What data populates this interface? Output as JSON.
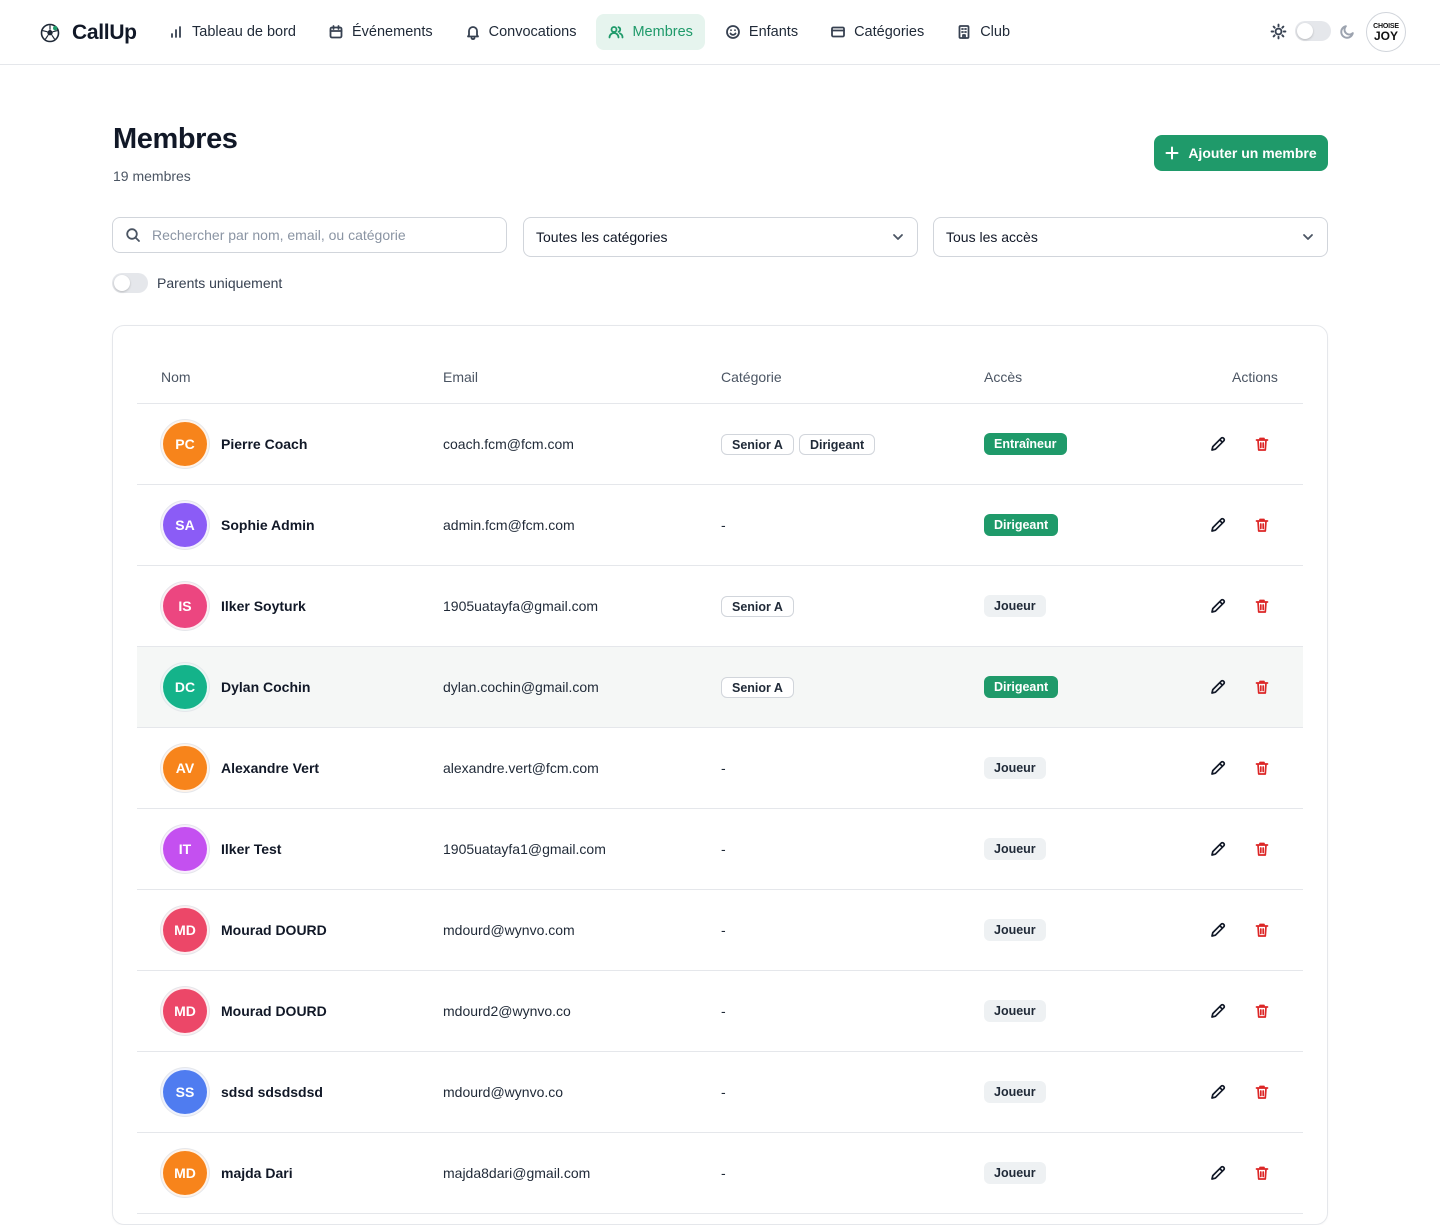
{
  "app": {
    "name": "CallUp"
  },
  "nav": [
    {
      "id": "dashboard",
      "label": "Tableau de bord",
      "icon": "bar-chart-icon",
      "active": false
    },
    {
      "id": "events",
      "label": "Événements",
      "icon": "calendar-icon",
      "active": false
    },
    {
      "id": "convocations",
      "label": "Convocations",
      "icon": "bell-icon",
      "active": false
    },
    {
      "id": "members",
      "label": "Membres",
      "icon": "users-icon",
      "active": true
    },
    {
      "id": "children",
      "label": "Enfants",
      "icon": "smile-icon",
      "active": false
    },
    {
      "id": "categories",
      "label": "Catégories",
      "icon": "card-icon",
      "active": false
    },
    {
      "id": "club",
      "label": "Club",
      "icon": "building-icon",
      "active": false
    }
  ],
  "user": {
    "avatar_line1": "CHOISE",
    "avatar_line2": "JOY"
  },
  "header": {
    "title": "Membres",
    "count": "19 membres",
    "add_label": "Ajouter un membre"
  },
  "filters": {
    "search_placeholder": "Rechercher par nom, email, ou catégorie",
    "category_select": "Toutes les catégories",
    "access_select": "Tous les accès",
    "parents_only_label": "Parents uniquement"
  },
  "table": {
    "columns": {
      "name": "Nom",
      "email": "Email",
      "category": "Catégorie",
      "access": "Accès",
      "actions": "Actions"
    },
    "rows": [
      {
        "initials": "PC",
        "name": "Pierre Coach",
        "email": "coach.fcm@fcm.com",
        "categories": [
          "Senior A",
          "Dirigeant"
        ],
        "access": "Entraîneur",
        "access_style": "green",
        "color": "#f7841b"
      },
      {
        "initials": "SA",
        "name": "Sophie Admin",
        "email": "admin.fcm@fcm.com",
        "categories": [],
        "access": "Dirigeant",
        "access_style": "green",
        "color": "#8b5cf6"
      },
      {
        "initials": "IS",
        "name": "Ilker Soyturk",
        "email": "1905uatayfa@gmail.com",
        "categories": [
          "Senior A"
        ],
        "access": "Joueur",
        "access_style": "grey",
        "color": "#ec4680"
      },
      {
        "initials": "DC",
        "name": "Dylan Cochin",
        "email": "dylan.cochin@gmail.com",
        "categories": [
          "Senior A"
        ],
        "access": "Dirigeant",
        "access_style": "green",
        "color": "#14b38a"
      },
      {
        "initials": "AV",
        "name": "Alexandre Vert",
        "email": "alexandre.vert@fcm.com",
        "categories": [],
        "access": "Joueur",
        "access_style": "grey",
        "color": "#f7841b"
      },
      {
        "initials": "IT",
        "name": "Ilker Test",
        "email": "1905uatayfa1@gmail.com",
        "categories": [],
        "access": "Joueur",
        "access_style": "grey",
        "color": "#c450f0"
      },
      {
        "initials": "MD",
        "name": "Mourad DOURD",
        "email": "mdourd@wynvo.com",
        "categories": [],
        "access": "Joueur",
        "access_style": "grey",
        "color": "#ec4768"
      },
      {
        "initials": "MD",
        "name": "Mourad DOURD",
        "email": "mdourd2@wynvo.co",
        "categories": [],
        "access": "Joueur",
        "access_style": "grey",
        "color": "#ec4768"
      },
      {
        "initials": "SS",
        "name": "sdsd sdsdsdsd",
        "email": "mdourd@wynvo.co",
        "categories": [],
        "access": "Joueur",
        "access_style": "grey",
        "color": "#4f7cf0"
      },
      {
        "initials": "MD",
        "name": "majda Dari",
        "email": "majda8dari@gmail.com",
        "categories": [],
        "access": "Joueur",
        "access_style": "grey",
        "color": "#f7841b"
      }
    ],
    "empty_category": "-"
  }
}
